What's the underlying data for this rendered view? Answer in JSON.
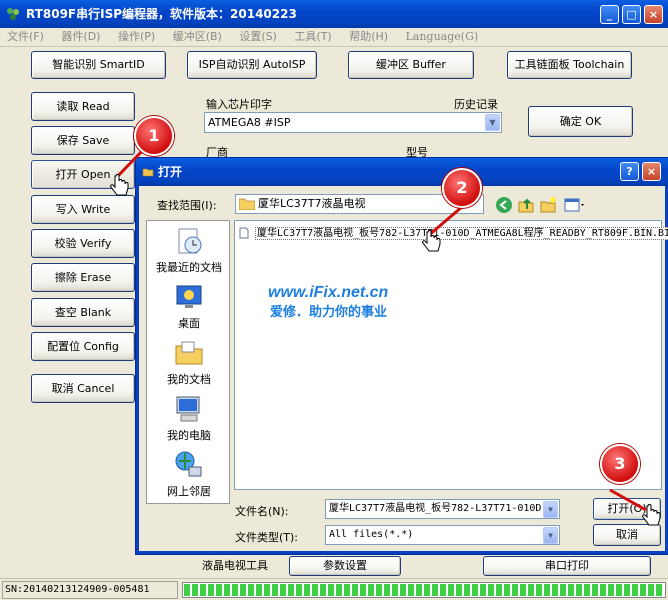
{
  "window": {
    "title": "RT809F串行ISP编程器，软件版本：20140223",
    "min_label": "_",
    "max_label": "□",
    "close_label": "×"
  },
  "menu": [
    "文件(F)",
    "器件(D)",
    "操作(P)",
    "缓冲区(B)",
    "设置(S)",
    "工具(T)",
    "帮助(H)",
    "Language(G)"
  ],
  "toolbar": {
    "smartid": "智能识别 SmartID",
    "autoisp": "ISP自动识别 AutoISP",
    "buffer": "缓冲区 Buffer",
    "toolchain": "工具链面板 Toolchain"
  },
  "side_buttons": [
    "读取 Read",
    "保存 Save",
    "打开 Open",
    "写入 Write",
    "校验 Verify",
    "擦除 Erase",
    "查空 Blank",
    "配置位 Config",
    "取消 Cancel"
  ],
  "chip": {
    "input_label": "输入芯片印字",
    "history_label": "历史记录",
    "value": "ATMEGA8 #ISP",
    "ok_button": "确定 OK",
    "vendor_label": "厂商",
    "model_label": "型号"
  },
  "dialog": {
    "title": "打开",
    "help_label": "?",
    "close_label": "×",
    "look_in_label": "查找范围(I):",
    "look_in_value": "厦华LC37T7液晶电视",
    "places": [
      "我最近的文档",
      "桌面",
      "我的文档",
      "我的电脑",
      "网上邻居"
    ],
    "file": "厦华LC37T7液晶电视_板号782-L37T71-010D_ATMEGA8L程序_READBY_RT809F.BIN.BIN",
    "filename_label": "文件名(N):",
    "filename_value": "厦华LC37T7液晶电视_板号782-L37T71-010D",
    "filetype_label": "文件类型(T):",
    "filetype_value": "All files(*.*)",
    "open_button": "打开(O)",
    "cancel_button": "取消"
  },
  "bottom_tabs": [
    "液晶电视工具",
    "参数设置",
    "串口打印"
  ],
  "status": {
    "sn": "SN:20140213124909-005481",
    "progress": 100
  },
  "watermark": {
    "url": "www.iFix.net.cn",
    "slogan": "爱修．助力你的事业"
  },
  "callouts": [
    "1",
    "2",
    "3"
  ],
  "colors": {
    "title_blue": "#0346c8",
    "callout_red": "#d10d0d",
    "watermark_blue": "#1f7fe0",
    "progress_green": "#3fd045"
  }
}
